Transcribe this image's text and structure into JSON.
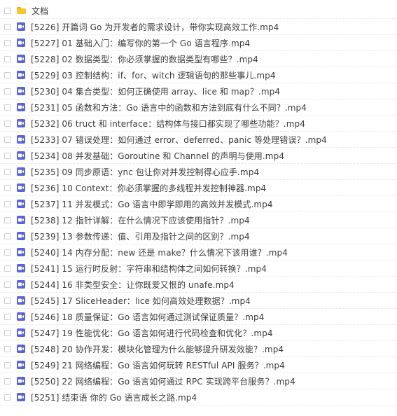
{
  "folder": {
    "name": "文档",
    "icon": "folder-icon"
  },
  "files": [
    {
      "name": "[5226] 开篇词 Go 为开发者的需求设计，带你实现高效工作.mp4",
      "icon": "video-file-icon"
    },
    {
      "name": "[5227] 01 基础入门：编写你的第一个 Go 语言程序.mp4",
      "icon": "video-file-icon"
    },
    {
      "name": "[5228] 02 数据类型：你必须掌握的数据类型有哪些？.mp4",
      "icon": "video-file-icon"
    },
    {
      "name": "[5229] 03 控制结构：if、for、witch 逻辑语句的那些事儿.mp4",
      "icon": "video-file-icon"
    },
    {
      "name": "[5230] 04 集合类型：如何正确使用 array、lice 和 map？.mp4",
      "icon": "video-file-icon"
    },
    {
      "name": "[5231] 05 函数和方法：Go 语言中的函数和方法到底有什么不同？.mp4",
      "icon": "video-file-icon"
    },
    {
      "name": "[5232] 06 truct 和 interface：结构体与接口都实现了哪些功能？.mp4",
      "icon": "video-file-icon"
    },
    {
      "name": "[5233] 07 错误处理：如何通过 error、deferred、panic 等处理错误？.mp4",
      "icon": "video-file-icon"
    },
    {
      "name": "[5234] 08 并发基础：Goroutine 和 Channel 的声明与使用.mp4",
      "icon": "video-file-icon"
    },
    {
      "name": "[5235] 09 同步原语：ync 包让你对并发控制得心应手.mp4",
      "icon": "video-file-icon"
    },
    {
      "name": "[5236] 10 Context：你必须掌握的多线程并发控制神器.mp4",
      "icon": "video-file-icon"
    },
    {
      "name": "[5237] 11 并发模式：Go 语言中即学即用的高效并发模式.mp4",
      "icon": "video-file-icon"
    },
    {
      "name": "[5238] 12 指针详解：在什么情况下应该使用指针？.mp4",
      "icon": "video-file-icon"
    },
    {
      "name": "[5239] 13 参数传递：值、引用及指针之间的区别？.mp4",
      "icon": "video-file-icon"
    },
    {
      "name": "[5240] 14 内存分配：new 还是 make？什么情况下该用谁？.mp4",
      "icon": "video-file-icon"
    },
    {
      "name": "[5241] 15 运行时反射：字符串和结构体之间如何转换？.mp4",
      "icon": "video-file-icon"
    },
    {
      "name": "[5244] 16 非类型安全：让你既爱又恨的 unafe.mp4",
      "icon": "video-file-icon"
    },
    {
      "name": "[5245] 17 SliceHeader：lice 如何高效处理数据？.mp4",
      "icon": "video-file-icon"
    },
    {
      "name": "[5246] 18 质量保证：Go 语言如何通过测试保证质量？.mp4",
      "icon": "video-file-icon"
    },
    {
      "name": "[5247] 19 性能优化：Go 语言如何进行代码检查和优化？.mp4",
      "icon": "video-file-icon"
    },
    {
      "name": "[5248] 20 协作开发：模块化管理为什么能够提升研发效能？.mp4",
      "icon": "video-file-icon"
    },
    {
      "name": "[5249] 21 网络编程：Go 语言如何玩转 RESTful API 服务？.mp4",
      "icon": "video-file-icon"
    },
    {
      "name": "[5250] 22 网络编程：Go 语言如何通过 RPC 实现跨平台服务？.mp4",
      "icon": "video-file-icon"
    },
    {
      "name": "[5251] 结束语 你的 Go 语言成长之路.mp4",
      "icon": "video-file-icon"
    }
  ],
  "colors": {
    "folder": "#f7c531",
    "video_icon": "#5b63d6",
    "text": "#3c3c3c",
    "checkbox_border": "#cfcfcf"
  }
}
